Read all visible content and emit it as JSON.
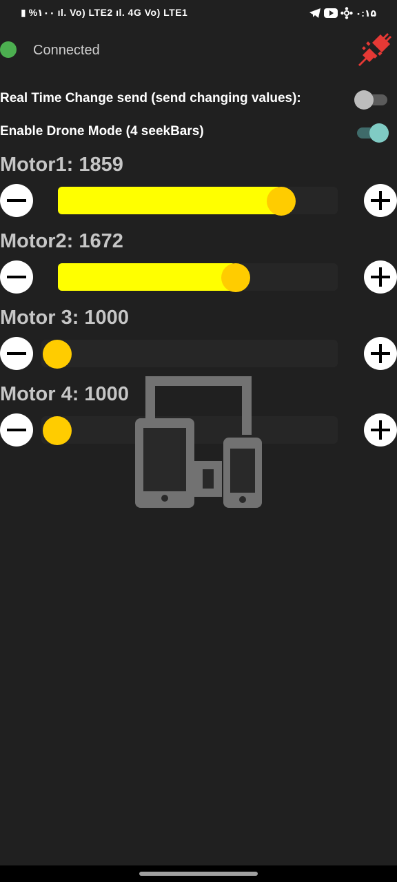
{
  "status_bar": {
    "left_text": "▮ %۱۰۰  ıl. Vo) LTE2  ıl. 4G Vo) LTE1",
    "time": "۰:۱۵"
  },
  "connection": {
    "status_text": "Connected",
    "status_color": "#4caf50",
    "disconnect_icon": "plug-disconnect-icon"
  },
  "settings": {
    "realtime": {
      "label": "Real Time Change send (send changing values):",
      "enabled": false
    },
    "drone_mode": {
      "label": "Enable Drone Mode (4 seekBars)",
      "enabled": true
    }
  },
  "motors": [
    {
      "title": "Motor1: 1859",
      "value": 1859,
      "min": 1000,
      "max": 2000
    },
    {
      "title": "Motor2: 1672",
      "value": 1672,
      "min": 1000,
      "max": 2000
    },
    {
      "title": "Motor 3: 1000",
      "value": 1000,
      "min": 1000,
      "max": 2000
    },
    {
      "title": "Motor 4: 1000",
      "value": 1000,
      "min": 1000,
      "max": 2000
    }
  ],
  "colors": {
    "slider_fill": "#ffff00",
    "slider_knob": "#ffcc00",
    "switch_on": "#80cbc4",
    "disconnect_icon": "#e53935"
  }
}
